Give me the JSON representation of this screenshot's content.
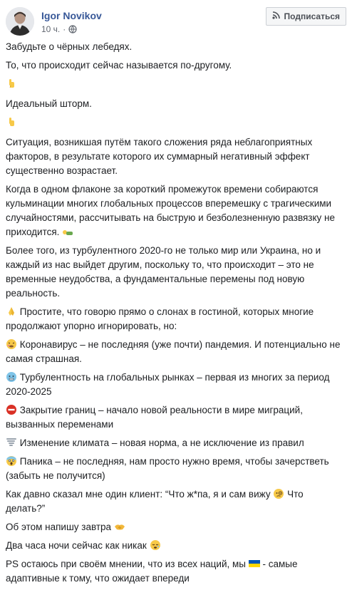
{
  "author": {
    "name": "Igor Novikov"
  },
  "meta": {
    "time": "10 ч.",
    "separator": "·"
  },
  "subscribe_label": "Подписаться",
  "paragraphs": {
    "p1": "Забудьте о чёрных лебедях.",
    "p2": "То, что происходит сейчас называется по-другому.",
    "p3": "Идеальный шторм.",
    "p4": "Ситуация, возникшая путём такого сложения ряда неблагоприятных факторов, в результате которого их суммарный негативный эффект существенно возрастает.",
    "p5": "Когда в одном флаконе за короткий промежуток времени собираются кульминации многих глобальных процессов вперемешку с трагическими случайностями, рассчитывать на быструю и безболезненную развязку не приходится.",
    "p6": "Более того, из турбулентного 2020-го не только мир или Украина, но и каждый из нас выйдет другим, поскольку то, что происходит – это не временные неудобства, а фундаментальные перемены под новую реальность.",
    "p7": "Простите, что говорю прямо о слонах в гостиной, которых многие продолжают упорно игнорировать, но:",
    "p8": "Коронавирус – не последняя (уже почти) пандемия. И потенциально не самая страшная.",
    "p9": "Турбулентность на глобальных рынках – первая из многих за период 2020-2025",
    "p10": "Закрытие границ – начало новой реальности в мире миграций, вызванных переменами",
    "p11": "Изменение климата – новая норма, а не исключение из правил",
    "p12": "Паника – не последняя, нам просто нужно время, чтобы зачерстветь (забыть не получится)",
    "p13a": "Как давно сказал мне один клиент: “Что ж*па, я и сам вижу",
    "p13b": "Что делать?”",
    "p14": "Об этом напишу завтра",
    "p15": "Два часа ночи сейчас как никак",
    "p16a": "PS остаюсь при своём мнении, что из всех наций, мы",
    "p16b": "- самые адаптивные к тому, что ожидает впереди"
  },
  "icons": {
    "avatar": "avatar",
    "globe": "globe-icon",
    "rss": "rss-icon",
    "pointing": "pointing-down-emoji",
    "person": "person-lying-emoji",
    "pray": "folded-hands-emoji",
    "sick": "sick-face-emoji",
    "cold": "cold-sweat-face-emoji",
    "noentry": "no-entry-emoji",
    "tornado": "tornado-emoji",
    "scream": "screaming-face-emoji",
    "monocle": "face-with-monocle-emoji",
    "handshake": "handshake-emoji",
    "sleepy": "sleepy-face-emoji",
    "flag": "ukraine-flag-emoji"
  },
  "colors": {
    "author_link": "#385898",
    "meta_text": "#616770",
    "body_text": "#1c1e21",
    "ukraine_blue": "#0057b7",
    "ukraine_yellow": "#ffd700"
  }
}
